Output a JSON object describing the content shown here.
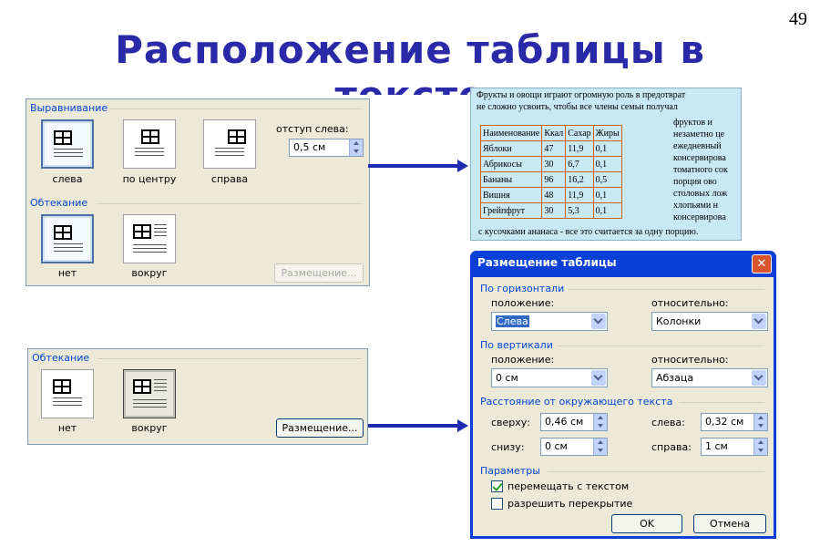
{
  "slide": {
    "page_number": "49",
    "title_line1": "Расположение таблицы в",
    "title_line2": "тексте"
  },
  "panel_top": {
    "alignment_group": "Выравнивание",
    "align_options": [
      "слева",
      "по центру",
      "справа"
    ],
    "indent_label": "отступ слева:",
    "indent_value": "0,5 см",
    "wrap_group": "Обтекание",
    "wrap_options": [
      "нет",
      "вокруг"
    ],
    "placement_button": "Размещение..."
  },
  "panel_bottom": {
    "wrap_group": "Обтекание",
    "wrap_options": [
      "нет",
      "вокруг"
    ],
    "placement_button": "Размещение..."
  },
  "document": {
    "line1": "Фрукты и овощи играют огромную роль в предотврат",
    "line2": "не сложно усвоить, чтобы все члены семьи получал",
    "side_lines": [
      "фруктов  и",
      "незаметно  це",
      "ежедневный",
      "консервирова",
      "томатного сок",
      "порция    ово",
      "столовых лож",
      "хлопьями   н",
      "консервирова"
    ],
    "bottom_line": "с кусочками ананаса - все это считается за одну порцию.",
    "table_header": [
      "Наименование",
      "Ккал",
      "Сахар",
      "Жиры"
    ],
    "table_rows": [
      [
        "Яблоки",
        "47",
        "11,9",
        "0,1"
      ],
      [
        "Абрикосы",
        "30",
        "6,7",
        "0,1"
      ],
      [
        "Бананы",
        "96",
        "16,2",
        "0,5"
      ],
      [
        "Вишня",
        "48",
        "11,9",
        "0,1"
      ],
      [
        "Грейпфрут",
        "30",
        "5,3",
        "0,1"
      ]
    ]
  },
  "dialog": {
    "title": "Размещение таблицы",
    "horizontal_group": "По горизонтали",
    "h_position_label": "положение:",
    "h_position_value": "Слева",
    "h_relative_label": "относительно:",
    "h_relative_value": "Колонки",
    "vertical_group": "По вертикали",
    "v_position_label": "положение:",
    "v_position_value": "0 см",
    "v_relative_label": "относительно:",
    "v_relative_value": "Абзаца",
    "distance_group": "Расстояние от окружающего текста",
    "top_label": "сверху:",
    "top_value": "0,46 см",
    "bottom_label": "снизу:",
    "bottom_value": "0 см",
    "left_label": "слева:",
    "left_value": "0,32 см",
    "right_label": "справа:",
    "right_value": "1 см",
    "params_group": "Параметры",
    "move_with_text": "перемещать с текстом",
    "move_with_text_checked": true,
    "allow_overlap": "разрешить перекрытие",
    "allow_overlap_checked": false,
    "ok_button": "OK",
    "cancel_button": "Отмена"
  },
  "colors": {
    "title": "#2a2aa8",
    "arrow": "#1f2bb0",
    "dialog_titlebar": "#0a3fd8",
    "group_label": "#0046d5"
  }
}
